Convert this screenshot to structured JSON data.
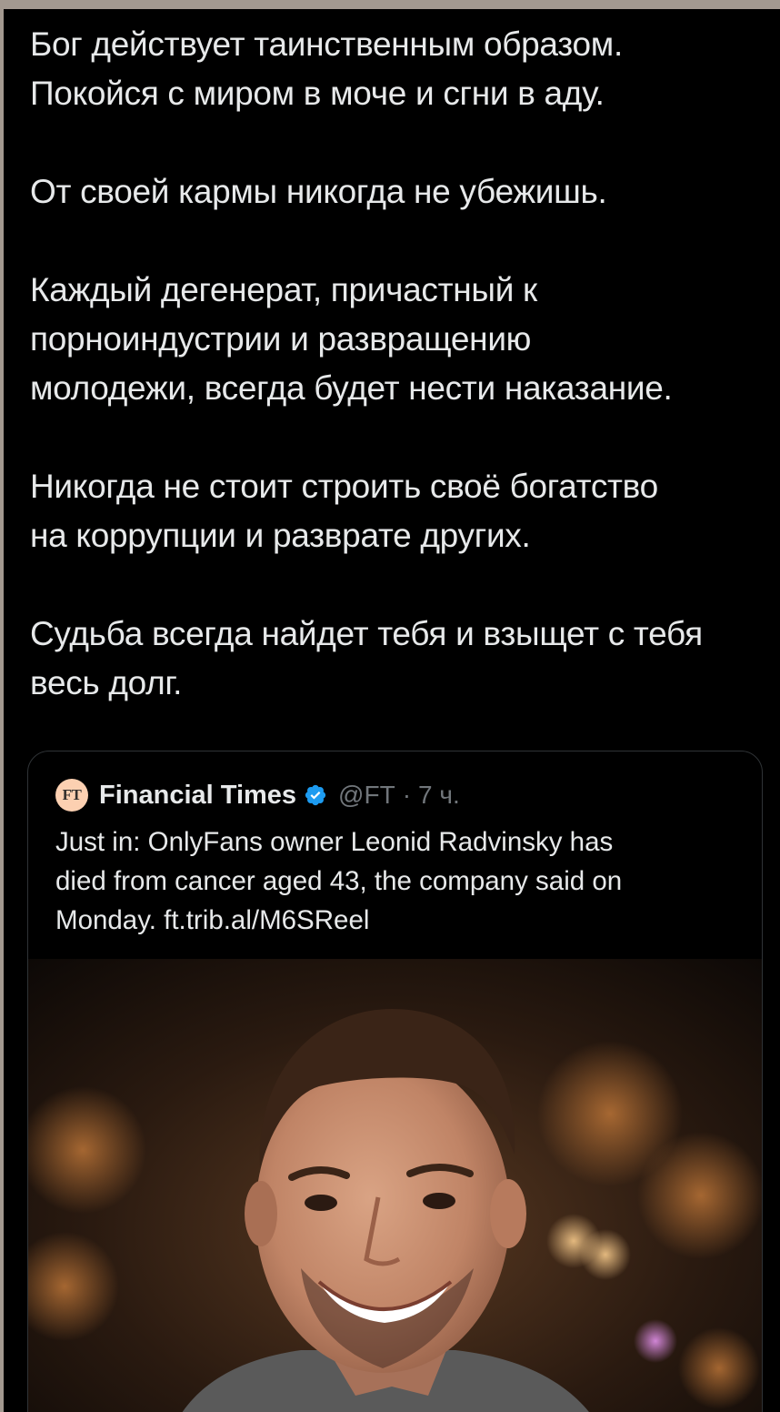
{
  "post": {
    "paragraphs": [
      [
        "Бог действует таинственным образом.",
        "Покойся с миром в моче и сгни в аду."
      ],
      [
        "От своей кармы никогда не убежишь."
      ],
      [
        "Каждый дегенерат, причастный к",
        "порноиндустрии и развращению",
        "молодежи, всегда будет нести наказание."
      ],
      [
        "Никогда не стоит строить своё богатство",
        "на коррупции и разврате других."
      ],
      [
        "Судьба всегда найдет тебя и взыщет с тебя",
        "весь долг."
      ]
    ]
  },
  "quote": {
    "logo_text": "FT",
    "source_name": "Financial Times",
    "verified_icon": "verified-badge-icon",
    "handle": "@FT",
    "separator": "·",
    "time": "7 ч.",
    "text_lines": [
      "Just in: OnlyFans owner Leonid Radvinsky has",
      "died from cancer aged 43, the company said on",
      "Monday. ft.trib.al/M6SReel"
    ],
    "media": "portrait photo of a smiling man with short dark hair and stubble"
  },
  "colors": {
    "background": "#000000",
    "text": "#e7e9ea",
    "secondary_text": "#71767b",
    "card_border": "#2f3336",
    "verified": "#1d9bf0",
    "ft_logo_bg": "#fcd0b1"
  }
}
